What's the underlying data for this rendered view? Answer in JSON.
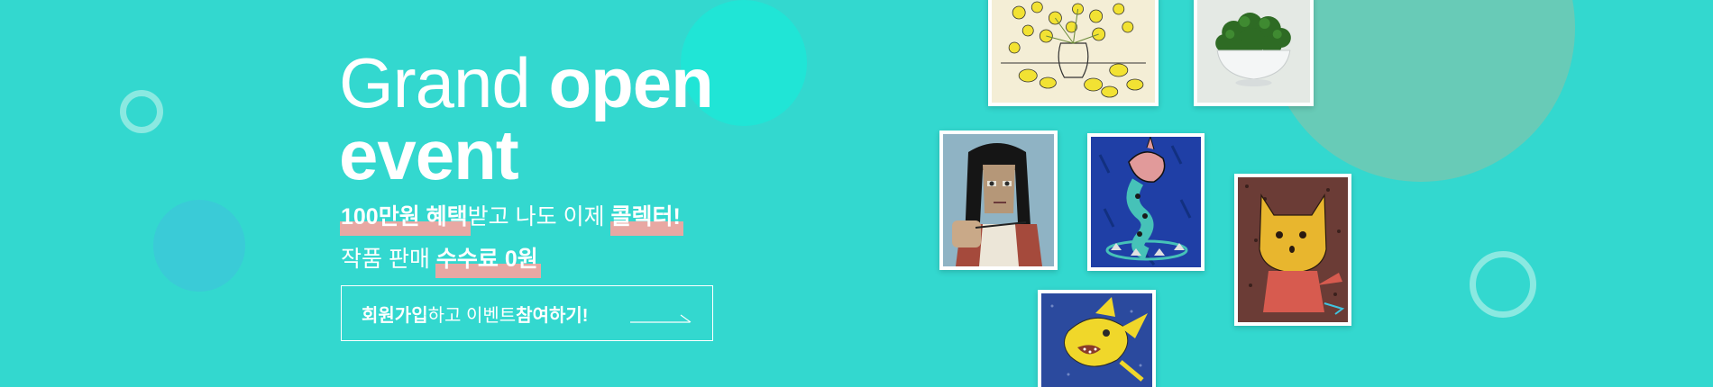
{
  "headline": {
    "line1_light": "Grand",
    "line1_bold": "open",
    "line2_bold": "event"
  },
  "subline1": {
    "highlight_1": "100만원 혜택",
    "text_1": "받고 나도 이제 ",
    "highlight_2": "콜렉터!"
  },
  "subline2": {
    "text_1": "작품 판매 ",
    "highlight_1": "수수료 0원"
  },
  "cta": {
    "bold_1": "회원가입",
    "text_1": "하고 이벤트 ",
    "bold_2": "참여하기!"
  },
  "artworks": [
    {
      "subject": "lemons-still-life-icon"
    },
    {
      "subject": "moss-bowl-icon"
    },
    {
      "subject": "woman-portrait-icon"
    },
    {
      "subject": "blue-creature-icon"
    },
    {
      "subject": "yellow-cat-icon"
    },
    {
      "subject": "yellow-fish-icon"
    }
  ],
  "colors": {
    "background": "#33d8cf",
    "highlight": "#e8a8a3",
    "text": "#ffffff"
  }
}
